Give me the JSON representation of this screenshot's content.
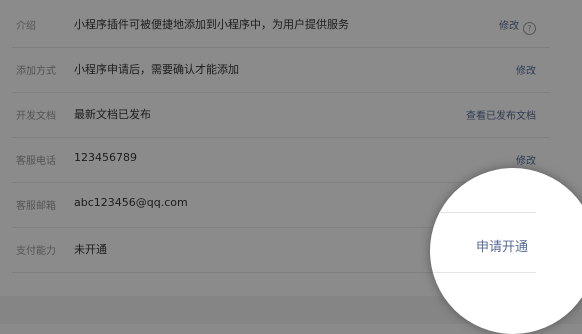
{
  "settings": {
    "rows": [
      {
        "label": "介绍",
        "value": "小程序插件可被便捷地添加到小程序中，为用户提供服务",
        "action": "修改"
      },
      {
        "label": "添加方式",
        "value": "小程序申请后，需要确认才能添加",
        "action": "修改"
      },
      {
        "label": "开发文档",
        "value": "最新文档已发布",
        "action": "查看已发布文档"
      },
      {
        "label": "客服电话",
        "value": "123456789",
        "action": "修改"
      },
      {
        "label": "客服邮箱",
        "value": "abc123456@qq.com",
        "action": ""
      },
      {
        "label": "支付能力",
        "value": "未开通",
        "action": ""
      }
    ],
    "help_icon": "?"
  },
  "magnifier": {
    "apply_label": "申请开通"
  }
}
